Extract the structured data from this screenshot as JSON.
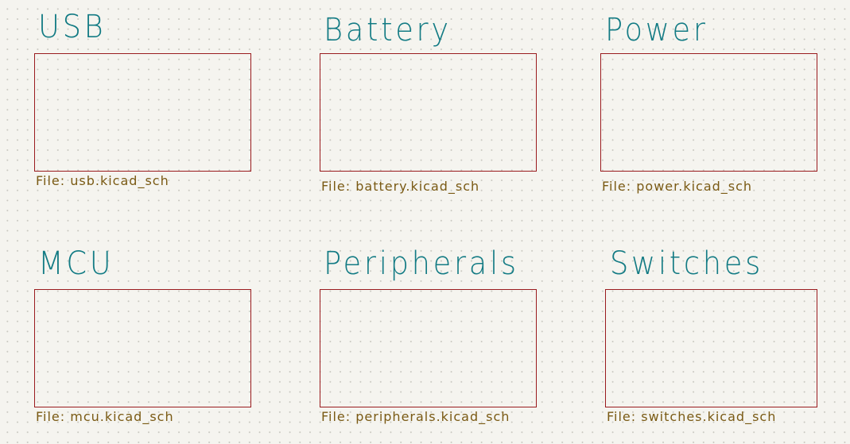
{
  "sheets": [
    {
      "name": "USB",
      "file": "File: usb.kicad_sch"
    },
    {
      "name": "Battery",
      "file": "File: battery.kicad_sch"
    },
    {
      "name": "Power",
      "file": "File: power.kicad_sch"
    },
    {
      "name": "MCU",
      "file": "File: mcu.kicad_sch"
    },
    {
      "name": "Peripherals",
      "file": "File: peripherals.kicad_sch"
    },
    {
      "name": "Switches",
      "file": "File: switches.kicad_sch"
    }
  ],
  "colors": {
    "background": "#f5f4ef",
    "sheet_name": "#137b84",
    "sheet_border": "#9a1b1e",
    "sheet_file": "#7a5a14"
  }
}
